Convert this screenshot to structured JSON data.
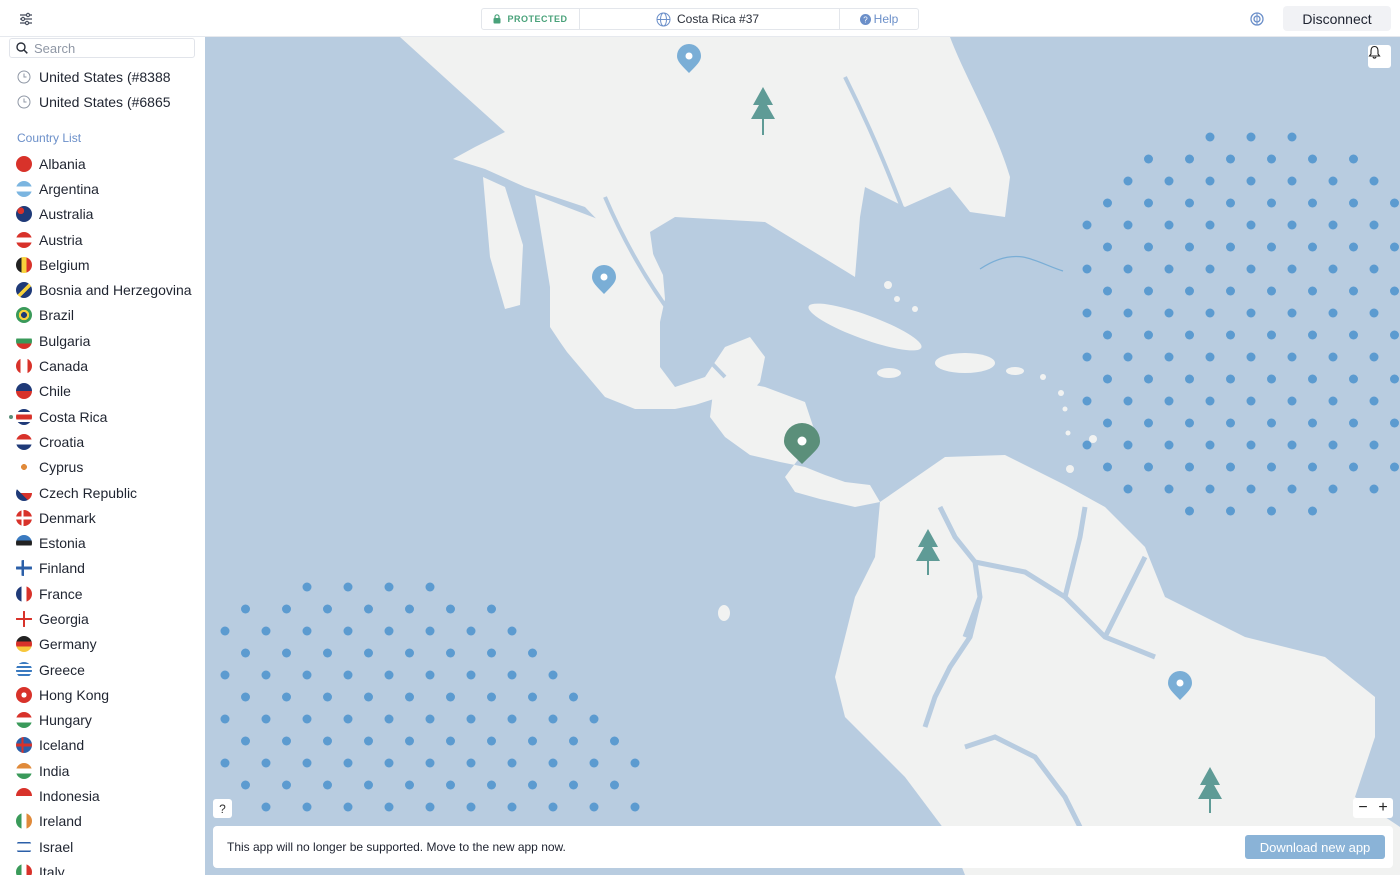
{
  "topbar": {
    "settings_icon": "sliders-icon",
    "status": "PROTECTED",
    "server": "Costa Rica #37",
    "help": "Help",
    "quick_connect_icon": "quick-connect-icon",
    "disconnect": "Disconnect"
  },
  "search": {
    "placeholder": "Search"
  },
  "recent": [
    {
      "label": "United States (#8388"
    },
    {
      "label": "United States (#6865"
    }
  ],
  "country_list_label": "Country List",
  "countries": [
    {
      "name": "Albania"
    },
    {
      "name": "Argentina"
    },
    {
      "name": "Australia"
    },
    {
      "name": "Austria"
    },
    {
      "name": "Belgium"
    },
    {
      "name": "Bosnia and Herzegovina"
    },
    {
      "name": "Brazil"
    },
    {
      "name": "Bulgaria"
    },
    {
      "name": "Canada"
    },
    {
      "name": "Chile"
    },
    {
      "name": "Costa Rica"
    },
    {
      "name": "Croatia"
    },
    {
      "name": "Cyprus"
    },
    {
      "name": "Czech Republic"
    },
    {
      "name": "Denmark"
    },
    {
      "name": "Estonia"
    },
    {
      "name": "Finland"
    },
    {
      "name": "France"
    },
    {
      "name": "Georgia"
    },
    {
      "name": "Germany"
    },
    {
      "name": "Greece"
    },
    {
      "name": "Hong Kong"
    },
    {
      "name": "Hungary"
    },
    {
      "name": "Iceland"
    },
    {
      "name": "India"
    },
    {
      "name": "Indonesia"
    },
    {
      "name": "Ireland"
    },
    {
      "name": "Israel"
    },
    {
      "name": "Italy"
    }
  ],
  "active_country": "Costa Rica",
  "map": {
    "help": "?",
    "zoom_out": "−",
    "zoom_in": "+",
    "notice": "This app will no longer be supported. Move to the new app now.",
    "download": "Download new app"
  },
  "colors": {
    "accent": "#6b8fc9",
    "protected": "#49a27a",
    "ocean": "#b8cce0",
    "land": "#f1f2f1",
    "active_pin": "#5b8f7a",
    "pin": "#7aaed6"
  }
}
